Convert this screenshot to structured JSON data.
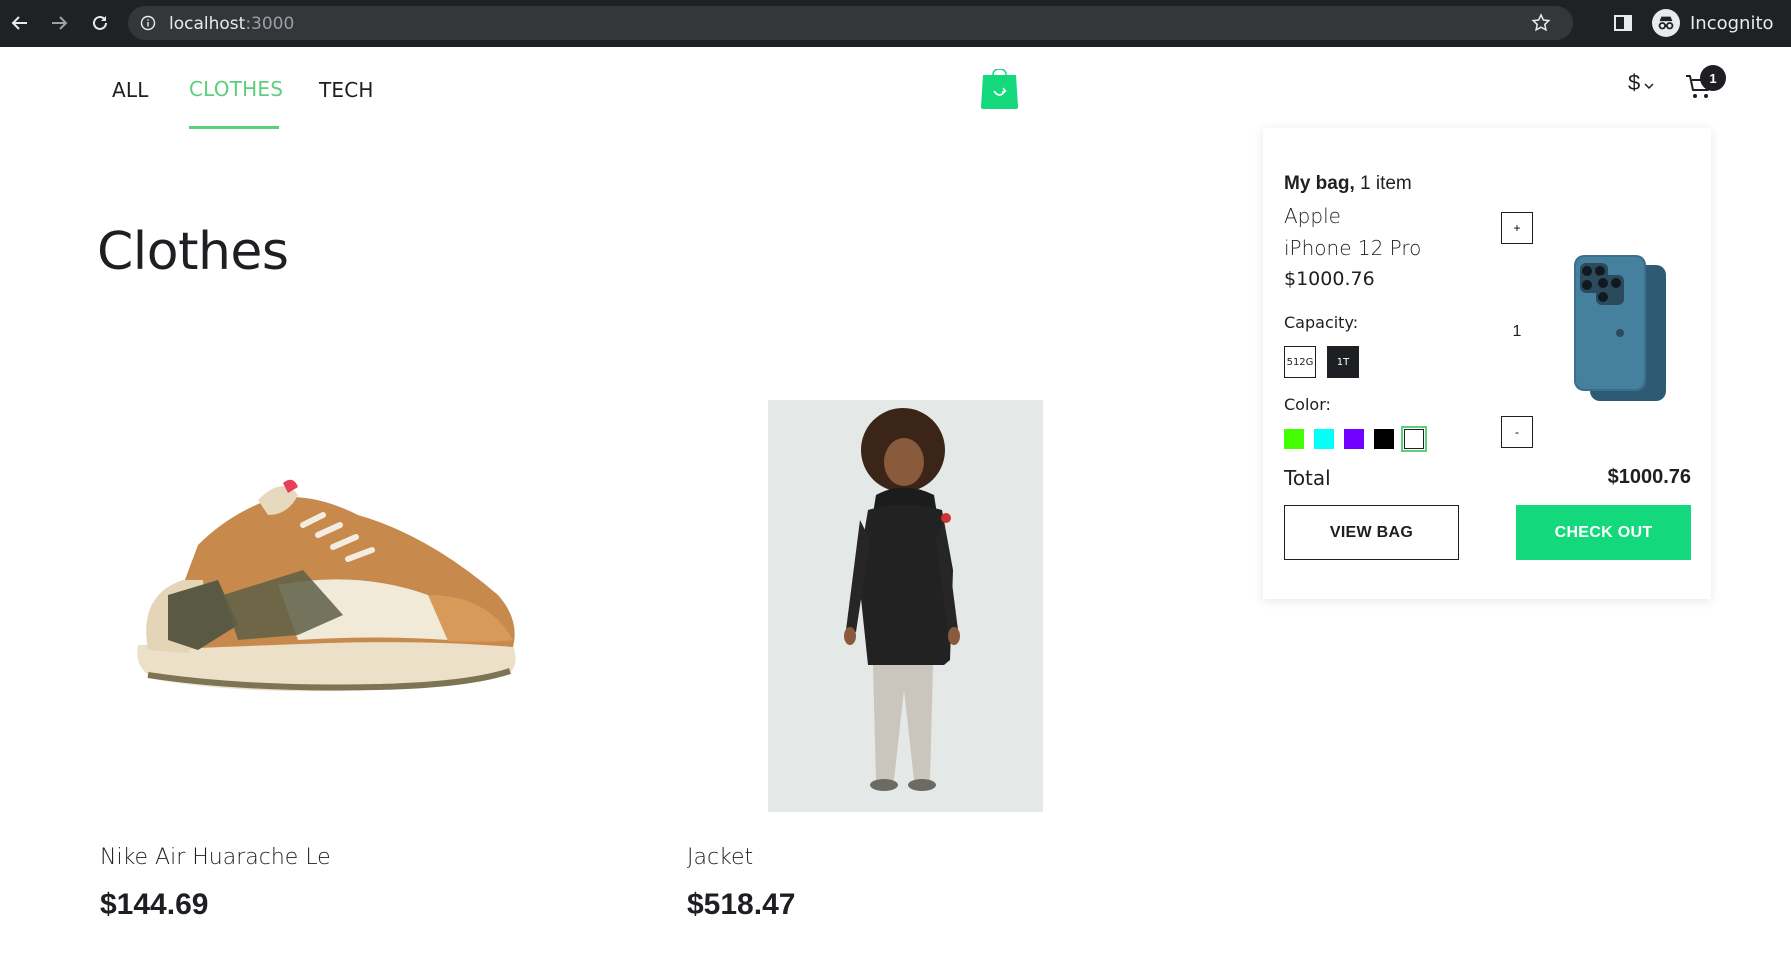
{
  "browser": {
    "url_host": "localhost",
    "url_port": ":3000",
    "incognito_label": "Incognito"
  },
  "header": {
    "categories": [
      {
        "label": "ALL",
        "active": false
      },
      {
        "label": "CLOTHES",
        "active": true
      },
      {
        "label": "TECH",
        "active": false
      }
    ],
    "currency_symbol": "$",
    "cart_count": "1",
    "accent_color": "#5ece7b"
  },
  "page": {
    "title": "Clothes"
  },
  "products": [
    {
      "name": "Nike Air Huarache Le",
      "price": "$144.69",
      "image": "sneaker-image"
    },
    {
      "name": "Jacket",
      "price": "$518.47",
      "image": "jacket-image"
    }
  ],
  "minicart": {
    "title_bold": "My bag,",
    "title_rest": " 1 item",
    "item": {
      "brand": "Apple",
      "name": "iPhone 12 Pro",
      "price": "$1000.76",
      "capacity_label": "Capacity:",
      "capacities": [
        {
          "label": "512G",
          "selected": false
        },
        {
          "label": "1T",
          "selected": true
        }
      ],
      "color_label": "Color:",
      "colors": [
        {
          "hex": "#44FF03",
          "selected": false
        },
        {
          "hex": "#03FFF7",
          "selected": false
        },
        {
          "hex": "#7000ff",
          "selected": false
        },
        {
          "hex": "#000000",
          "selected": false
        },
        {
          "hex": "#ffffff",
          "selected": true
        }
      ],
      "quantity": "1",
      "plus_label": "+",
      "minus_label": "-"
    },
    "total_label": "Total",
    "total_value": "$1000.76",
    "view_bag_label": "VIEW BAG",
    "checkout_label": "CHECK OUT"
  }
}
